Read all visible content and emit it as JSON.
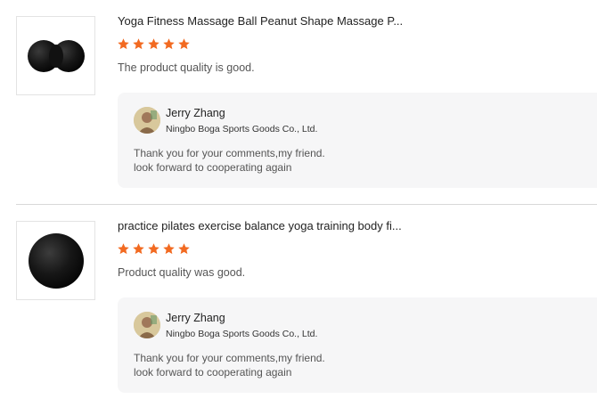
{
  "colors": {
    "star": "#f26a21",
    "reply_bg": "#f6f6f7"
  },
  "reviews": [
    {
      "image_icon": "peanut-massage-ball-icon",
      "product_title": "Yoga Fitness Massage Ball Peanut Shape Massage P...",
      "rating": 5,
      "rating_max": 5,
      "comment": "The product quality is good.",
      "reply": {
        "name": "Jerry Zhang",
        "company": "Ningbo Boga Sports Goods Co., Ltd.",
        "line1": "Thank you for your comments,my friend.",
        "line2": "look forward to cooperating again"
      }
    },
    {
      "image_icon": "round-massage-ball-icon",
      "product_title": "practice pilates exercise balance yoga training body fi...",
      "rating": 5,
      "rating_max": 5,
      "comment": "Product quality was good.",
      "reply": {
        "name": "Jerry Zhang",
        "company": "Ningbo Boga Sports Goods Co., Ltd.",
        "line1": "Thank you for your comments,my friend.",
        "line2": "look forward to cooperating again"
      }
    }
  ]
}
